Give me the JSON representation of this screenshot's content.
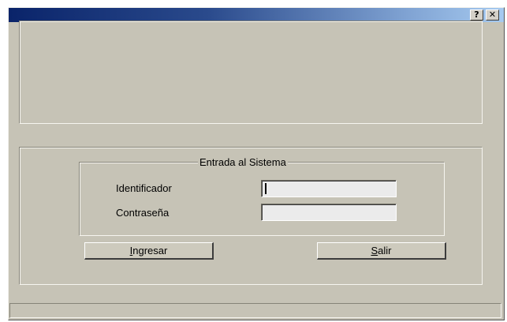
{
  "titlebar": {
    "title": "",
    "help_label": "?",
    "close_label": "✕"
  },
  "login_group": {
    "title": "Entrada al Sistema",
    "user_label": "Identificador",
    "password_label": "Contraseña",
    "user_value": "",
    "password_value": ""
  },
  "buttons": {
    "login_accel": "I",
    "login_rest": "ngresar",
    "exit_accel": "S",
    "exit_rest": "alir"
  },
  "statusbar": {
    "text": ""
  },
  "colors": {
    "window_bg": "#c6c3b6",
    "titlebar_start": "#0a246a",
    "titlebar_end": "#a6caf0",
    "textbox_bg": "#ebebeb"
  }
}
